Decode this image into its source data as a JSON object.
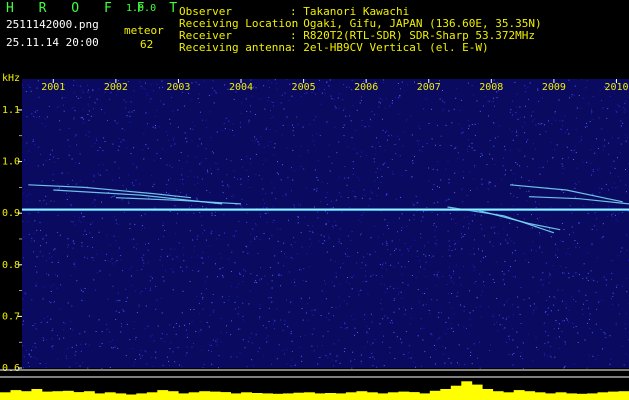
{
  "header": {
    "app_name": "H R O F F T",
    "version": "1.0.0",
    "filename": "2511142000.png",
    "datetime": "25.11.14 20:00",
    "mode_label": "meteor",
    "meteor_count": "62",
    "info_rows": [
      {
        "label": "Observer",
        "value": ": Takanori Kawachi"
      },
      {
        "label": "Receiving Location",
        "value": ": Ogaki, Gifu, JAPAN (136.60E, 35.35N)"
      },
      {
        "label": "Receiver",
        "value": ": R820T2(RTL-SDR) SDR-Sharp 53.372MHz"
      },
      {
        "label": "Receiving antenna",
        "value": ": 2el-HB9CV Vertical (el. E-W)"
      }
    ]
  },
  "colors": {
    "background": "#000000",
    "noise_base": "#0a0a60",
    "carrier": "#50c8ff",
    "label_yellow": "#f0f000",
    "label_green": "#40ff40",
    "activity_bar": "#ffff00"
  },
  "chart_data": {
    "type": "heatmap",
    "xlabel": "",
    "ylabel": "kHz",
    "x_ticks": [
      "2001",
      "2002",
      "2003",
      "2004",
      "2005",
      "2006",
      "2007",
      "2008",
      "2009",
      "2010"
    ],
    "x_range": [
      2000.5,
      2010.2
    ],
    "y_ticks": [
      "1.1",
      "1.0",
      "0.9",
      "0.8",
      "0.7",
      "0.6"
    ],
    "ylim": [
      0.6,
      1.16
    ],
    "carrier_khz": 0.907,
    "meteor_traces": [
      {
        "points": [
          [
            2000.6,
            0.955
          ],
          [
            2001.5,
            0.95
          ],
          [
            2002.6,
            0.938
          ],
          [
            2003.2,
            0.93
          ]
        ]
      },
      {
        "points": [
          [
            2001.0,
            0.945
          ],
          [
            2002.4,
            0.935
          ],
          [
            2003.7,
            0.918
          ]
        ]
      },
      {
        "points": [
          [
            2002.0,
            0.93
          ],
          [
            2003.0,
            0.925
          ],
          [
            2004.0,
            0.918
          ]
        ]
      },
      {
        "points": [
          [
            2008.3,
            0.955
          ],
          [
            2009.2,
            0.945
          ],
          [
            2010.1,
            0.922
          ]
        ]
      },
      {
        "points": [
          [
            2007.3,
            0.912
          ],
          [
            2008.2,
            0.895
          ],
          [
            2009.0,
            0.862
          ]
        ]
      },
      {
        "points": [
          [
            2007.8,
            0.905
          ],
          [
            2008.6,
            0.88
          ],
          [
            2009.1,
            0.868
          ]
        ]
      },
      {
        "points": [
          [
            2008.6,
            0.932
          ],
          [
            2009.4,
            0.928
          ],
          [
            2010.2,
            0.918
          ]
        ]
      }
    ],
    "activity_profile": [
      0.35,
      0.45,
      0.4,
      0.5,
      0.38,
      0.4,
      0.42,
      0.36,
      0.4,
      0.3,
      0.35,
      0.3,
      0.25,
      0.3,
      0.35,
      0.45,
      0.4,
      0.3,
      0.35,
      0.4,
      0.38,
      0.36,
      0.3,
      0.35,
      0.32,
      0.3,
      0.28,
      0.3,
      0.33,
      0.35,
      0.3,
      0.32,
      0.3,
      0.35,
      0.4,
      0.35,
      0.3,
      0.35,
      0.38,
      0.36,
      0.3,
      0.42,
      0.5,
      0.65,
      0.85,
      0.7,
      0.5,
      0.4,
      0.35,
      0.45,
      0.4,
      0.35,
      0.3,
      0.35,
      0.3,
      0.28,
      0.3,
      0.35,
      0.38,
      0.4
    ]
  }
}
